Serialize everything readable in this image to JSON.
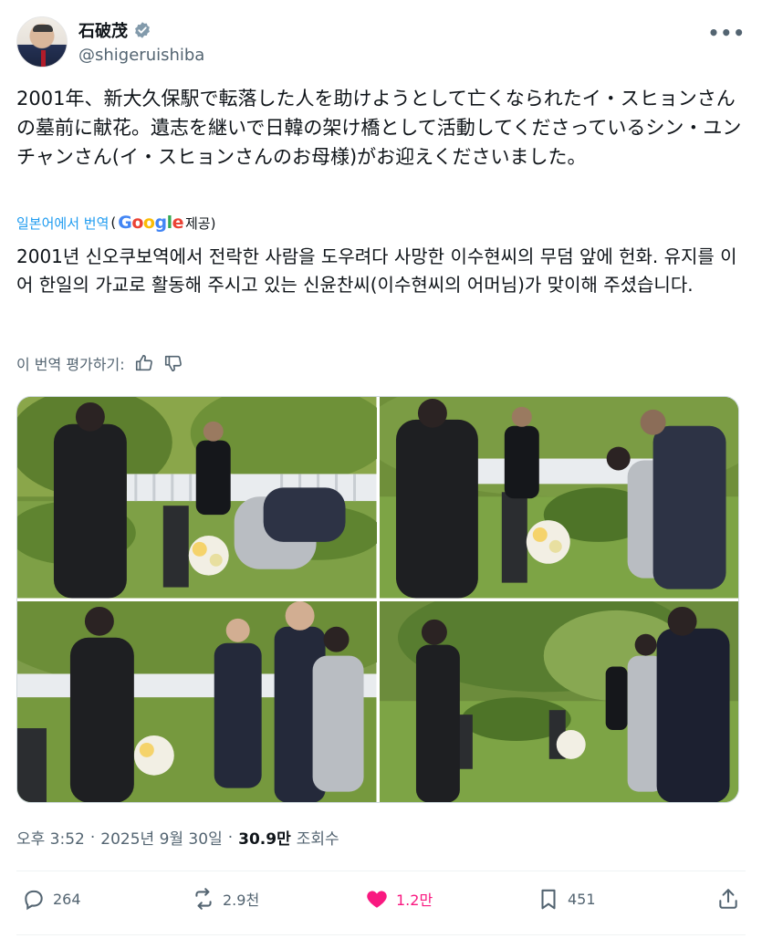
{
  "author": {
    "display_name": "石破茂",
    "handle": "@shigeruishiba",
    "verified_icon": "verified-badge-icon",
    "more_label": "•••"
  },
  "tweet": {
    "text": "2001年、新大久保駅で転落した人を助けようとして亡くなられたイ・スヒョンさんの墓前に献花。遺志を継いで日韓の架け橋として活動してくださっているシン・ユンチャンさん(イ・スヒョンさんのお母様)がお迎えくださいました。"
  },
  "translation": {
    "label": "일본어에서 번역",
    "open_paren": "(",
    "provider": "Google",
    "provider_suffix": "제공)",
    "text": "2001년 신오쿠보역에서 전락한 사람을 도우려다 사망한 이수현씨의 무덤 앞에 헌화. 유지를 이어 한일의 가교로 활동해 주시고 있는 신윤찬씨(이수현씨의 어머님)가 맞이해 주셨습니다.",
    "rate_label": "이 번역 평가하기:"
  },
  "meta": {
    "time": "오후 3:52",
    "separator": "·",
    "date": "2025년 9월 30일",
    "views_count": "30.9만",
    "views_label": "조회수"
  },
  "actions": {
    "replies": "264",
    "retweets": "2.9천",
    "likes": "1.2만",
    "bookmarks": "451"
  },
  "colors": {
    "accent": "#1d9bf0",
    "like": "#f91880",
    "muted": "#536471",
    "verified": "#829aab"
  }
}
